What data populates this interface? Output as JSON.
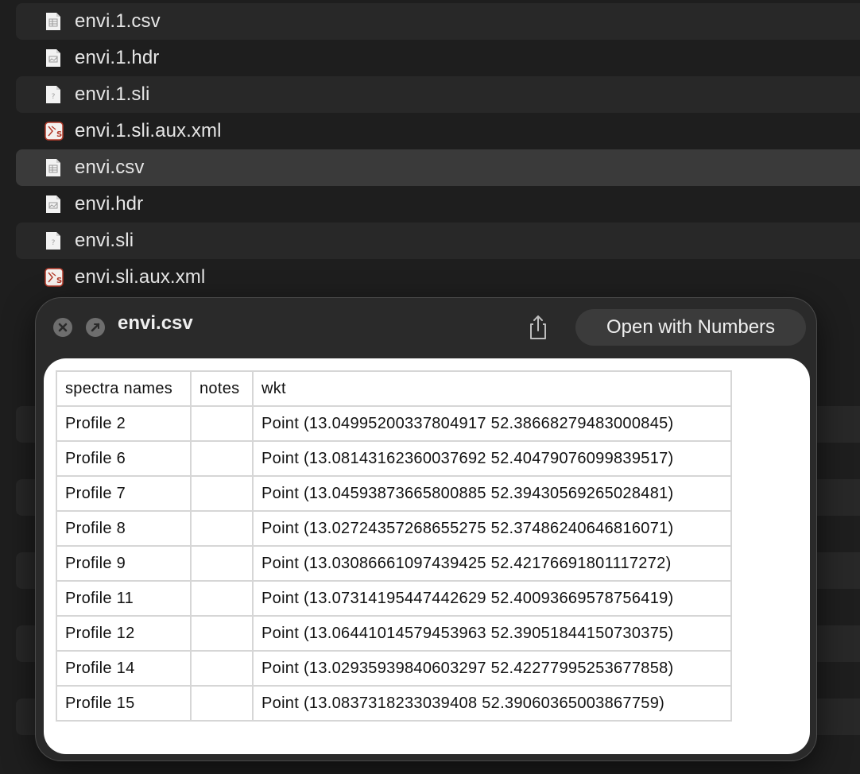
{
  "finder": {
    "files": [
      {
        "name": "envi.1.csv",
        "icon": "csv-file-icon"
      },
      {
        "name": "envi.1.hdr",
        "icon": "image-file-icon"
      },
      {
        "name": "envi.1.sli",
        "icon": "generic-file-icon"
      },
      {
        "name": "envi.1.sli.aux.xml",
        "icon": "qgis-xml-file-icon"
      },
      {
        "name": "envi.csv",
        "icon": "csv-file-icon"
      },
      {
        "name": "envi.hdr",
        "icon": "image-file-icon"
      },
      {
        "name": "envi.sli",
        "icon": "generic-file-icon"
      },
      {
        "name": "envi.sli.aux.xml",
        "icon": "qgis-xml-file-icon"
      }
    ],
    "selected_index": 4
  },
  "quicklook": {
    "title": "envi.csv",
    "open_button_label": "Open with Numbers",
    "close_icon": "close-icon",
    "fullscreen_icon": "fullscreen-icon",
    "share_icon": "share-icon"
  },
  "table": {
    "headers": [
      "spectra names",
      "notes",
      "wkt"
    ],
    "rows": [
      [
        "Profile 2",
        "",
        "Point (13.04995200337804917 52.38668279483000845)"
      ],
      [
        "Profile 6",
        "",
        "Point (13.08143162360037692 52.40479076099839517)"
      ],
      [
        "Profile 7",
        "",
        "Point (13.04593873665800885 52.39430569265028481)"
      ],
      [
        "Profile 8",
        "",
        "Point (13.02724357268655275 52.37486240646816071)"
      ],
      [
        "Profile 9",
        "",
        "Point (13.03086661097439425 52.42176691801117272)"
      ],
      [
        "Profile 11",
        "",
        "Point (13.07314195447442629 52.40093669578756419)"
      ],
      [
        "Profile 12",
        "",
        "Point (13.06441014579453963 52.39051844150730375)"
      ],
      [
        "Profile 14",
        "",
        "Point (13.02935939840603297 52.42277995253677858)"
      ],
      [
        "Profile 15",
        "",
        "Point (13.0837318233039408 52.39060365003867759)"
      ]
    ]
  },
  "colors": {
    "background": "#1e1e1e",
    "row_stripe": "#282828",
    "row_selected": "#3a3a3a",
    "panel": "#2a2a2a",
    "content": "#ffffff"
  }
}
